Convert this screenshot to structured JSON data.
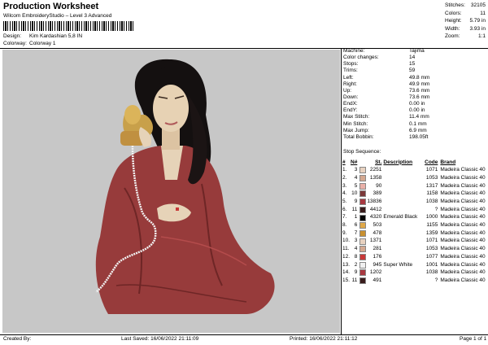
{
  "header": {
    "title": "Production Worksheet",
    "subtitle": "Wilcom EmbroideryStudio – Level 3 Advanced",
    "design_label": "Design:",
    "design_value": "Kim Kardashian 5,8 IN",
    "colorway_label": "Colorway:",
    "colorway_value": "Colorway 1"
  },
  "stats": [
    {
      "label": "Stitches:",
      "value": "32105"
    },
    {
      "label": "Colors:",
      "value": "11"
    },
    {
      "label": "Height:",
      "value": "5.79 in"
    },
    {
      "label": "Width:",
      "value": "3.93 in"
    },
    {
      "label": "Zoom:",
      "value": "1:1"
    }
  ],
  "info": [
    {
      "label": "Machine:",
      "value": "Tajima"
    },
    {
      "label": "Color changes:",
      "value": "14"
    },
    {
      "label": "Stops:",
      "value": "15"
    },
    {
      "label": "Trims:",
      "value": "59"
    },
    {
      "label": "Left:",
      "value": "49.8 mm"
    },
    {
      "label": "Right:",
      "value": "49.9 mm"
    },
    {
      "label": "Up:",
      "value": "73.6 mm"
    },
    {
      "label": "Down:",
      "value": "73.6 mm"
    },
    {
      "label": "EndX:",
      "value": "0.00 in"
    },
    {
      "label": "EndY:",
      "value": "0.00 in"
    },
    {
      "label": "Max Stitch:",
      "value": "11.4 mm"
    },
    {
      "label": "Min Stitch:",
      "value": "0.1 mm"
    },
    {
      "label": "Max Jump:",
      "value": "6.9 mm"
    },
    {
      "label": "Total Bobbin:",
      "value": "198.05ft"
    }
  ],
  "stop_sequence_label": "Stop Sequence:",
  "stop_headers": {
    "num": "#",
    "n": "N#",
    "st": "St.",
    "desc": "Description",
    "code": "Code",
    "brand": "Brand"
  },
  "stops": [
    {
      "num": "1.",
      "n": "3",
      "color": "#e8d2c0",
      "st": "2251",
      "desc": "",
      "code": "1071",
      "brand": "Madeira Classic 40"
    },
    {
      "num": "2.",
      "n": "4",
      "color": "#d4a890",
      "st": "1358",
      "desc": "",
      "code": "1053",
      "brand": "Madeira Classic 40"
    },
    {
      "num": "3.",
      "n": "5",
      "color": "#e9b0a8",
      "st": "90",
      "desc": "",
      "code": "1317",
      "brand": "Madeira Classic 40"
    },
    {
      "num": "4.",
      "n": "10",
      "color": "#7a3838",
      "st": "389",
      "desc": "",
      "code": "1158",
      "brand": "Madeira Classic 40"
    },
    {
      "num": "5.",
      "n": "9",
      "color": "#a83840",
      "st": "13836",
      "desc": "",
      "code": "1038",
      "brand": "Madeira Classic 40"
    },
    {
      "num": "6.",
      "n": "11",
      "color": "#3a1c1c",
      "st": "4412",
      "desc": "",
      "code": "?",
      "brand": "Madeira Classic 40"
    },
    {
      "num": "7.",
      "n": "1",
      "color": "#050505",
      "st": "4320",
      "desc": "Emerald Black",
      "code": "1000",
      "brand": "Madeira Classic 40"
    },
    {
      "num": "8.",
      "n": "6",
      "color": "#e0a848",
      "st": "503",
      "desc": "",
      "code": "1155",
      "brand": "Madeira Classic 40"
    },
    {
      "num": "9.",
      "n": "7",
      "color": "#c89030",
      "st": "478",
      "desc": "",
      "code": "1359",
      "brand": "Madeira Classic 40"
    },
    {
      "num": "10.",
      "n": "3",
      "color": "#e8d2c0",
      "st": "1371",
      "desc": "",
      "code": "1071",
      "brand": "Madeira Classic 40"
    },
    {
      "num": "11.",
      "n": "4",
      "color": "#d4a890",
      "st": "281",
      "desc": "",
      "code": "1053",
      "brand": "Madeira Classic 40"
    },
    {
      "num": "12.",
      "n": "8",
      "color": "#c83838",
      "st": "176",
      "desc": "",
      "code": "1077",
      "brand": "Madeira Classic 40"
    },
    {
      "num": "13.",
      "n": "2",
      "color": "#f0f0f0",
      "st": "945",
      "desc": "Super White",
      "code": "1001",
      "brand": "Madeira Classic 40"
    },
    {
      "num": "14.",
      "n": "9",
      "color": "#a83840",
      "st": "1202",
      "desc": "",
      "code": "1038",
      "brand": "Madeira Classic 40"
    },
    {
      "num": "15.",
      "n": "11",
      "color": "#3a1c1c",
      "st": "491",
      "desc": "",
      "code": "?",
      "brand": "Madeira Classic 40"
    }
  ],
  "footer": {
    "created": "Created By:",
    "saved": "Last Saved: 16/06/2022 21:11:09",
    "printed": "Printed: 16/06/2022 21:11:12",
    "page": "Page 1 of 1"
  }
}
